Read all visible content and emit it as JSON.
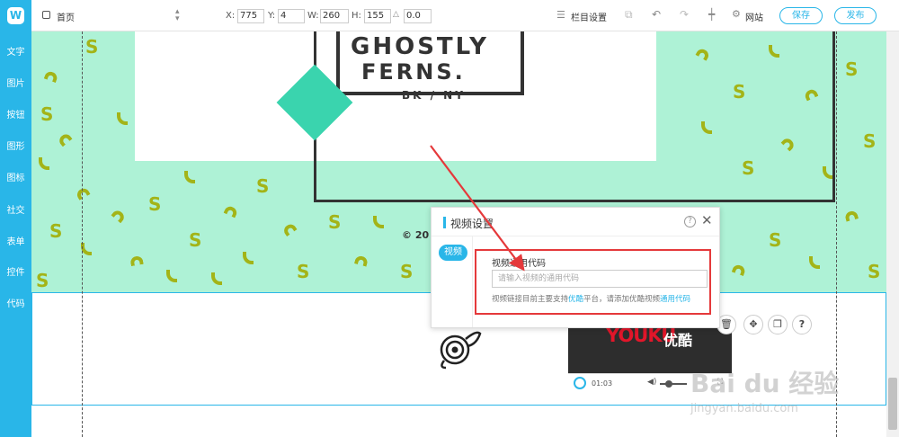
{
  "sidebar": {
    "logo": "W",
    "items": [
      {
        "label": "文字"
      },
      {
        "label": "图片"
      },
      {
        "label": "按钮"
      },
      {
        "label": "图形"
      },
      {
        "label": "图标"
      },
      {
        "label": "社交"
      },
      {
        "label": "表单"
      },
      {
        "label": "控件"
      },
      {
        "label": "代码"
      }
    ]
  },
  "toolbar": {
    "page_select": "首页",
    "x_label": "X:",
    "x_value": "775",
    "y_label": "Y:",
    "y_value": "4",
    "w_label": "W:",
    "w_value": "260",
    "h_label": "H:",
    "h_value": "155",
    "rotate_value": "0.0",
    "column_settings": "栏目设置",
    "site": "网站",
    "save": "保存",
    "publish": "发布"
  },
  "canvas": {
    "logo_line1": "GHOSTLY",
    "logo_line2": "FERNS.",
    "logo_sub": "BK / NY",
    "copyright": "© 20"
  },
  "video": {
    "brand": "YOUKU",
    "brand_cn": "优酷",
    "time": "01:03"
  },
  "dialog": {
    "title": "视频设置",
    "tab": "视频",
    "field_label": "视频通用代码",
    "input_placeholder": "请输入视频的通用代码",
    "hint_part1": "视频链接目前主要支持",
    "hint_link1": "优酷",
    "hint_part2": "平台，请添加优酷视频",
    "hint_link2": "通用代码"
  },
  "watermark": {
    "main": "Bai du 经验",
    "sub": "jingyan.baidu.com"
  },
  "colors": {
    "accent": "#29b6e8",
    "mint": "#aef2d6",
    "diamond": "#3ad4ae",
    "annotation": "#e5393b"
  }
}
